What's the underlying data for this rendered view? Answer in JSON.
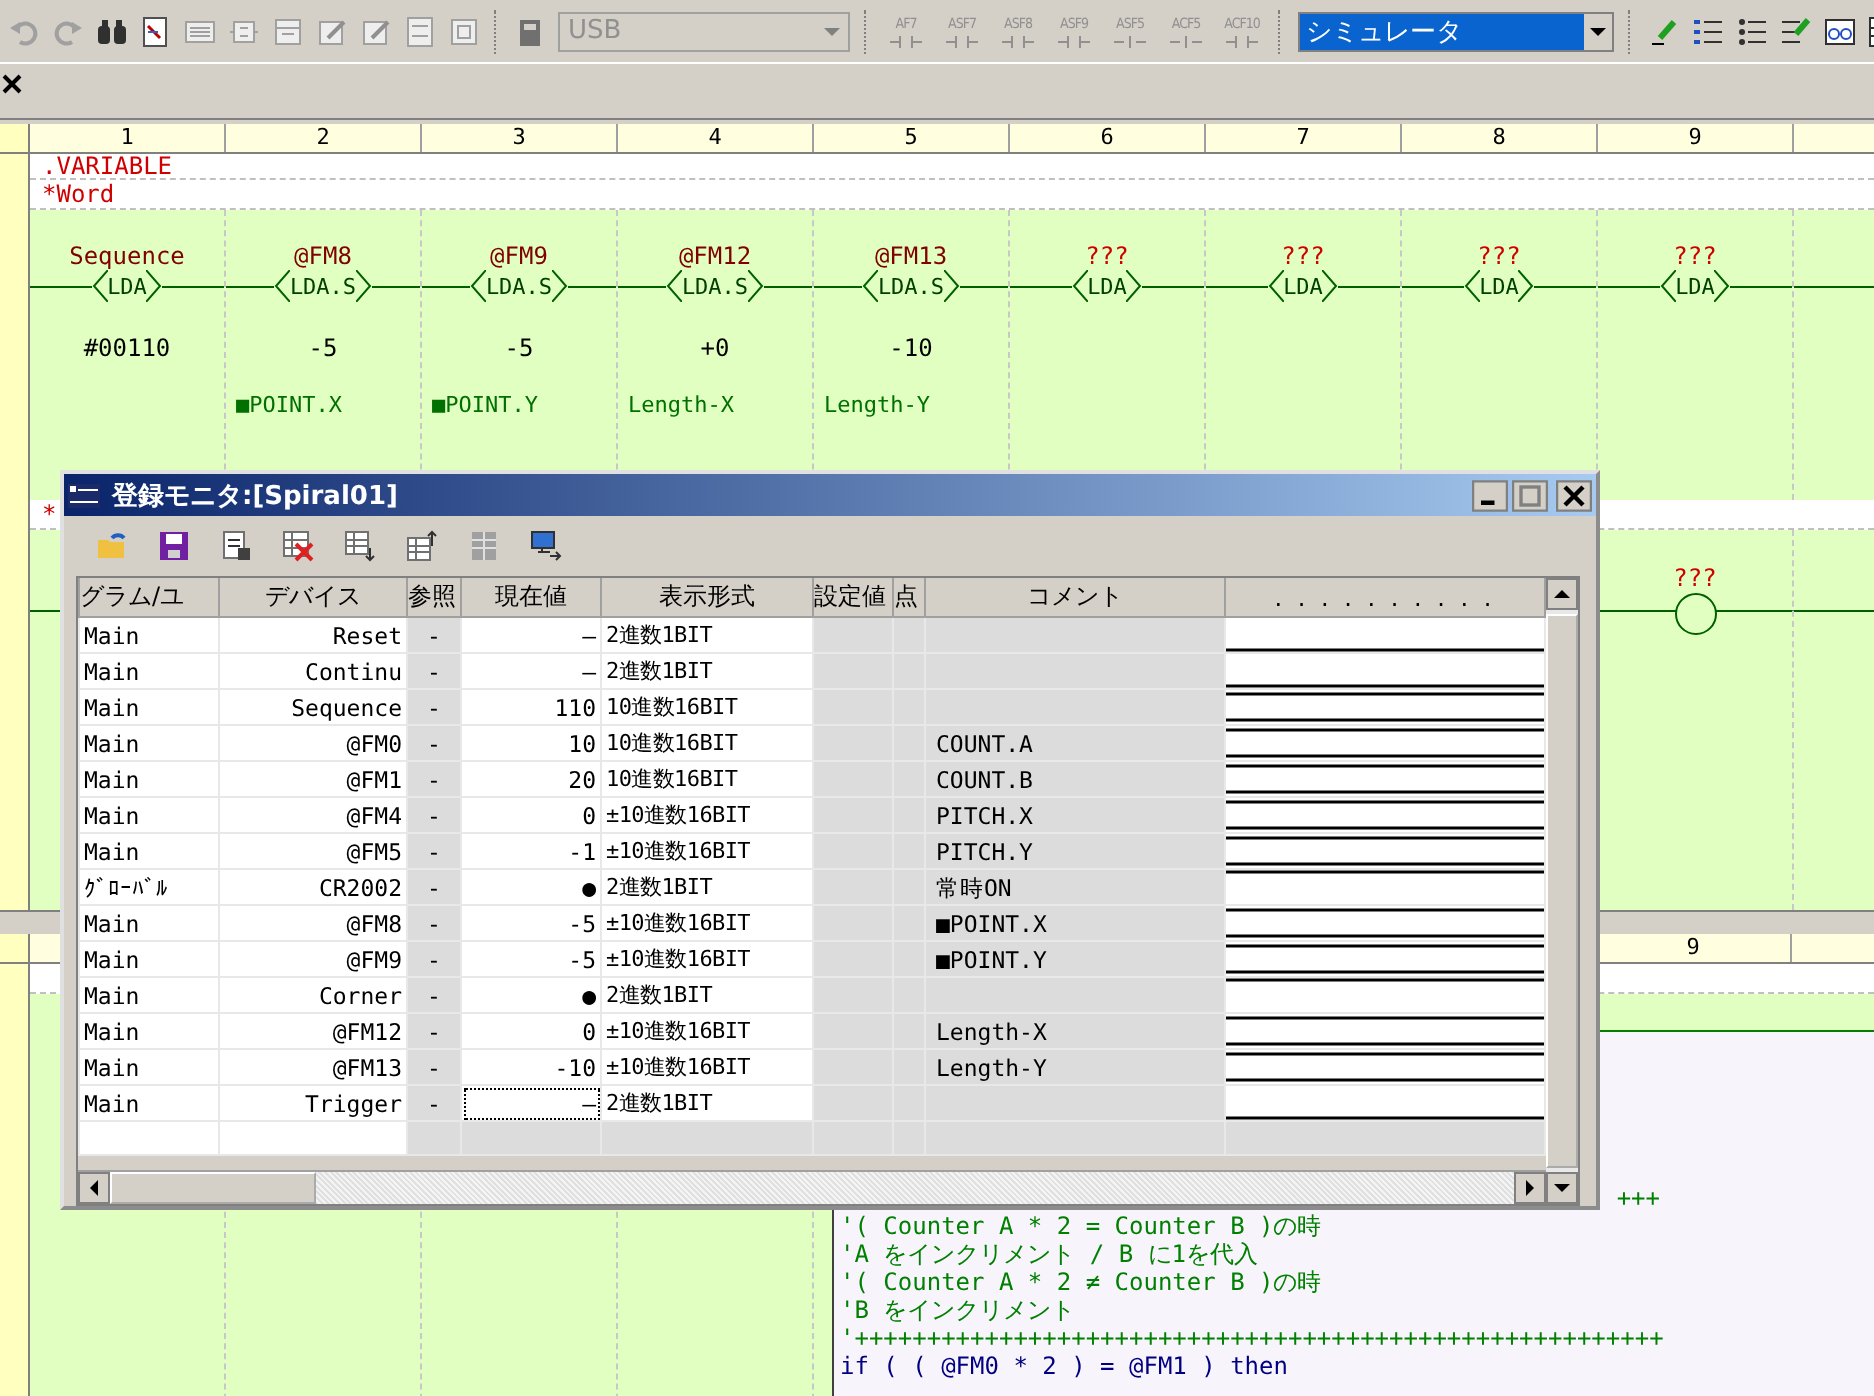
{
  "toolbar": {
    "port": "USB",
    "contact_buttons": [
      {
        "label": "AF7",
        "kind": "contact"
      },
      {
        "label": "ASF7",
        "kind": "contact"
      },
      {
        "label": "ASF8",
        "kind": "contact"
      },
      {
        "label": "ASF9",
        "kind": "contact"
      },
      {
        "label": "ASF5",
        "kind": "coil"
      },
      {
        "label": "ACF5",
        "kind": "coil"
      },
      {
        "label": "ACF10",
        "kind": "contact"
      }
    ],
    "mode": "シミュレータ"
  },
  "ladder": {
    "columns": [
      "1",
      "2",
      "3",
      "4",
      "5",
      "6",
      "7",
      "8",
      "9"
    ],
    "header_rows": [
      ".VARIABLE",
      "*Word"
    ],
    "rung": [
      {
        "kind": "device",
        "device": "Sequence",
        "instruction": "LDA",
        "value": "#00110"
      },
      {
        "kind": "device",
        "device": "@FM8",
        "instruction": "LDA.S",
        "value": "-5",
        "comment": "■POINT.X"
      },
      {
        "kind": "device",
        "device": "@FM9",
        "instruction": "LDA.S",
        "value": "-5",
        "comment": "■POINT.Y"
      },
      {
        "kind": "device",
        "device": "@FM12",
        "instruction": "LDA.S",
        "value": "+0",
        "comment": "Length-X"
      },
      {
        "kind": "device",
        "device": "@FM13",
        "instruction": "LDA.S",
        "value": "-10",
        "comment": "Length-Y"
      },
      {
        "kind": "unassigned",
        "device": "???",
        "instruction": "LDA"
      },
      {
        "kind": "unassigned",
        "device": "???",
        "instruction": "LDA"
      },
      {
        "kind": "unassigned",
        "device": "???",
        "instruction": "LDA"
      },
      {
        "kind": "unassigned",
        "device": "???",
        "instruction": "LDA"
      }
    ],
    "second_rung_marker": "*",
    "coil": {
      "kind": "unassigned",
      "device": "???"
    }
  },
  "lower_ladder": {
    "column_9": "9"
  },
  "code": [
    {
      "kind": "tail",
      "text": "+++"
    },
    {
      "kind": "comment",
      "text": "'( Counter A * 2 = Counter B )の時"
    },
    {
      "kind": "comment",
      "text": "'A をインクリメント / B に1を代入"
    },
    {
      "kind": "comment",
      "text": "'( Counter A * 2 ≠ Counter B )の時"
    },
    {
      "kind": "comment",
      "text": "'B をインクリメント"
    },
    {
      "kind": "comment",
      "text": "'++++++++++++++++++++++++++++++++++++++++++++++++++++++++"
    },
    {
      "kind": "code",
      "text": "if ( ( @FM0 * 2 ) = @FM1 ) then"
    }
  ],
  "monitor": {
    "title": "登録モニタ:[Spiral01]",
    "columns": [
      "グラム/ユ",
      "デバイス",
      "参照",
      "現在値",
      "表示形式",
      "設定値",
      "点",
      "コメント",
      ". . . . . . . . . ."
    ],
    "rows": [
      {
        "program": "Main",
        "device": "Reset",
        "ref": "-",
        "value": "—",
        "format": "2進数1BIT",
        "kind": "bit_off",
        "focused": false
      },
      {
        "program": "Main",
        "device": "Continu",
        "ref": "-",
        "value": "—",
        "format": "2進数1BIT",
        "kind": "bit_off",
        "focused": false
      },
      {
        "program": "Main",
        "device": "Sequence",
        "ref": "-",
        "value": "110",
        "format": "10進数16BIT",
        "kind": "word",
        "focused": false
      },
      {
        "program": "Main",
        "device": "@FM0",
        "ref": "-",
        "value": "10",
        "format": "10進数16BIT",
        "comment": "COUNT.A",
        "kind": "word",
        "focused": false
      },
      {
        "program": "Main",
        "device": "@FM1",
        "ref": "-",
        "value": "20",
        "format": "10進数16BIT",
        "comment": "COUNT.B",
        "kind": "word",
        "focused": false
      },
      {
        "program": "Main",
        "device": "@FM4",
        "ref": "-",
        "value": "0",
        "format": "±10進数16BIT",
        "comment": "PITCH.X",
        "kind": "word",
        "focused": false
      },
      {
        "program": "Main",
        "device": "@FM5",
        "ref": "-",
        "value": "-1",
        "format": "±10進数16BIT",
        "comment": "PITCH.Y",
        "kind": "word",
        "focused": false
      },
      {
        "program": "ｸﾞﾛｰﾊﾞﾙ",
        "device": "CR2002",
        "ref": "-",
        "value": "●",
        "format": "2進数1BIT",
        "comment": "常時ON",
        "kind": "bit_on",
        "focused": false
      },
      {
        "program": "Main",
        "device": "@FM8",
        "ref": "-",
        "value": "-5",
        "format": "±10進数16BIT",
        "comment": "■POINT.X",
        "kind": "word",
        "focused": false
      },
      {
        "program": "Main",
        "device": "@FM9",
        "ref": "-",
        "value": "-5",
        "format": "±10進数16BIT",
        "comment": "■POINT.Y",
        "kind": "word",
        "focused": false
      },
      {
        "program": "Main",
        "device": "Corner",
        "ref": "-",
        "value": "●",
        "format": "2進数1BIT",
        "kind": "bit_on",
        "focused": false
      },
      {
        "program": "Main",
        "device": "@FM12",
        "ref": "-",
        "value": "0",
        "format": "±10進数16BIT",
        "comment": "Length-X",
        "kind": "word",
        "focused": false
      },
      {
        "program": "Main",
        "device": "@FM13",
        "ref": "-",
        "value": "-10",
        "format": "±10進数16BIT",
        "comment": "Length-Y",
        "kind": "word",
        "focused": false
      },
      {
        "program": "Main",
        "device": "Trigger",
        "ref": "-",
        "value": "—",
        "format": "2進数1BIT",
        "kind": "bit_off",
        "focused": true
      }
    ]
  }
}
